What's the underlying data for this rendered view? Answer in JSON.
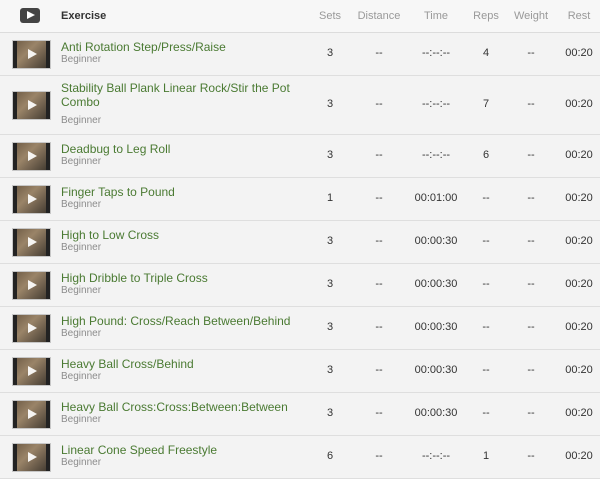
{
  "header": {
    "exercise": "Exercise",
    "sets": "Sets",
    "distance": "Distance",
    "time": "Time",
    "reps": "Reps",
    "weight": "Weight",
    "rest": "Rest"
  },
  "rows": [
    {
      "title": "Anti Rotation Step/Press/Raise",
      "level": "Beginner",
      "sets": "3",
      "distance": "--",
      "time": "--:--:--",
      "reps": "4",
      "weight": "--",
      "rest": "00:20"
    },
    {
      "title": "Stability Ball Plank Linear Rock/Stir the Pot Combo",
      "level": "Beginner",
      "sets": "3",
      "distance": "--",
      "time": "--:--:--",
      "reps": "7",
      "weight": "--",
      "rest": "00:20"
    },
    {
      "title": "Deadbug to Leg Roll",
      "level": "Beginner",
      "sets": "3",
      "distance": "--",
      "time": "--:--:--",
      "reps": "6",
      "weight": "--",
      "rest": "00:20"
    },
    {
      "title": "Finger Taps to Pound",
      "level": "Beginner",
      "sets": "1",
      "distance": "--",
      "time": "00:01:00",
      "reps": "--",
      "weight": "--",
      "rest": "00:20"
    },
    {
      "title": "High to Low Cross",
      "level": "Beginner",
      "sets": "3",
      "distance": "--",
      "time": "00:00:30",
      "reps": "--",
      "weight": "--",
      "rest": "00:20"
    },
    {
      "title": "High Dribble to Triple Cross",
      "level": "Beginner",
      "sets": "3",
      "distance": "--",
      "time": "00:00:30",
      "reps": "--",
      "weight": "--",
      "rest": "00:20"
    },
    {
      "title": "High Pound: Cross/Reach Between/Behind",
      "level": "Beginner",
      "sets": "3",
      "distance": "--",
      "time": "00:00:30",
      "reps": "--",
      "weight": "--",
      "rest": "00:20"
    },
    {
      "title": "Heavy Ball Cross/Behind",
      "level": "Beginner",
      "sets": "3",
      "distance": "--",
      "time": "00:00:30",
      "reps": "--",
      "weight": "--",
      "rest": "00:20"
    },
    {
      "title": "Heavy Ball Cross:Cross:Between:Between",
      "level": "Beginner",
      "sets": "3",
      "distance": "--",
      "time": "00:00:30",
      "reps": "--",
      "weight": "--",
      "rest": "00:20"
    },
    {
      "title": "Linear Cone Speed Freestyle",
      "level": "Beginner",
      "sets": "6",
      "distance": "--",
      "time": "--:--:--",
      "reps": "1",
      "weight": "--",
      "rest": "00:20"
    }
  ]
}
